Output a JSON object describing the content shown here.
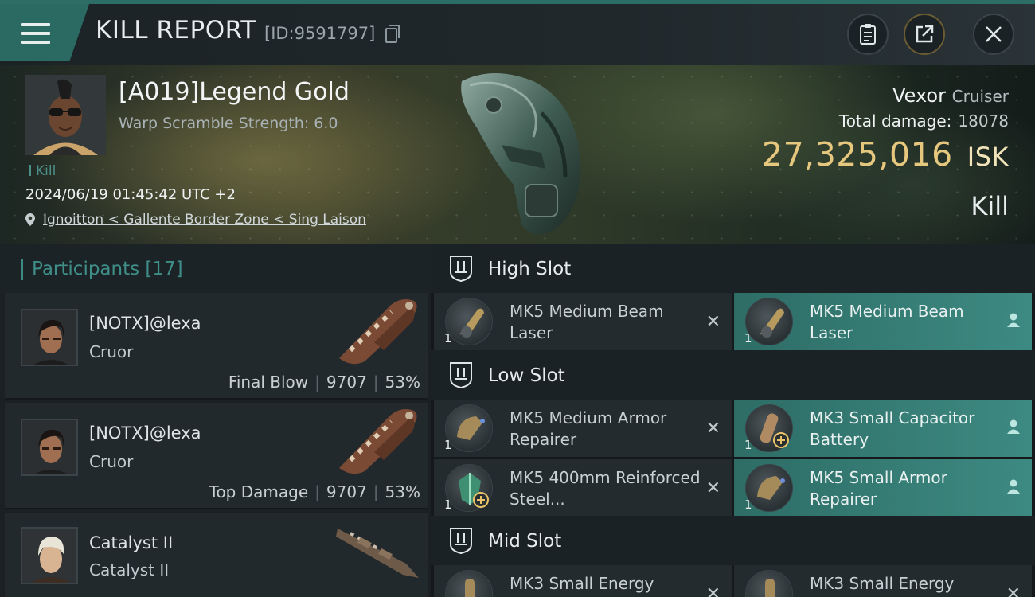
{
  "header": {
    "title": "KILL REPORT",
    "report_id": "[ID:9591797]"
  },
  "victim": {
    "name": "[A019]Legend Gold",
    "warp_scramble": "Warp Scramble Strength: 6.0",
    "kill_tag": "Kill",
    "datetime": "2024/06/19 01:45:42 UTC +2",
    "location": "Ignoitton < Gallente Border Zone < Sing Laison",
    "ship": "Vexor",
    "ship_class": "Cruiser",
    "total_damage_label": "Total damage:",
    "total_damage": "18078",
    "isk_value": "27,325,016",
    "isk_unit": "ISK",
    "result": "Kill"
  },
  "participants": {
    "label": "Participants",
    "count": "[17]",
    "items": [
      {
        "name": "[NOTX]@lexa",
        "ship": "Cruor",
        "role": "Final Blow",
        "damage": "9707",
        "percent": "53%"
      },
      {
        "name": "[NOTX]@lexa",
        "ship": "Cruor",
        "role": "Top Damage",
        "damage": "9707",
        "percent": "53%"
      },
      {
        "name": "Catalyst II",
        "ship": "Catalyst II",
        "role": "",
        "damage": "",
        "percent": ""
      }
    ]
  },
  "fitting": {
    "high_slot": {
      "label": "High Slot",
      "modules": [
        {
          "qty": "1",
          "name": "MK5 Medium Beam Laser",
          "state": "destroyed",
          "icon": "beam-laser-icon"
        },
        {
          "qty": "1",
          "name": "MK5 Medium Beam Laser",
          "state": "dropped",
          "icon": "beam-laser-icon"
        }
      ]
    },
    "low_slot": {
      "label": "Low Slot",
      "modules": [
        {
          "qty": "1",
          "name": "MK5 Medium Armor Repairer",
          "state": "destroyed",
          "icon": "armor-repairer-icon"
        },
        {
          "qty": "1",
          "name": "MK3 Small Capacitor Battery",
          "state": "dropped",
          "icon": "capacitor-battery-icon"
        },
        {
          "qty": "1",
          "name": "MK5 400mm Reinforced Steel...",
          "state": "destroyed",
          "icon": "armor-plate-icon"
        },
        {
          "qty": "1",
          "name": "MK5 Small Armor Repairer",
          "state": "dropped",
          "icon": "armor-repairer-icon"
        }
      ]
    },
    "mid_slot": {
      "label": "Mid Slot",
      "modules": [
        {
          "qty": "",
          "name": "MK3 Small Energy",
          "state": "destroyed",
          "icon": "energy-module-icon"
        },
        {
          "qty": "",
          "name": "MK3 Small Energy",
          "state": "destroyed",
          "icon": "energy-module-icon"
        }
      ]
    }
  },
  "colors": {
    "accent_teal": "#2b6a63",
    "dropped_teal": "#3d8a82",
    "isk_gold": "#e6c77e"
  }
}
